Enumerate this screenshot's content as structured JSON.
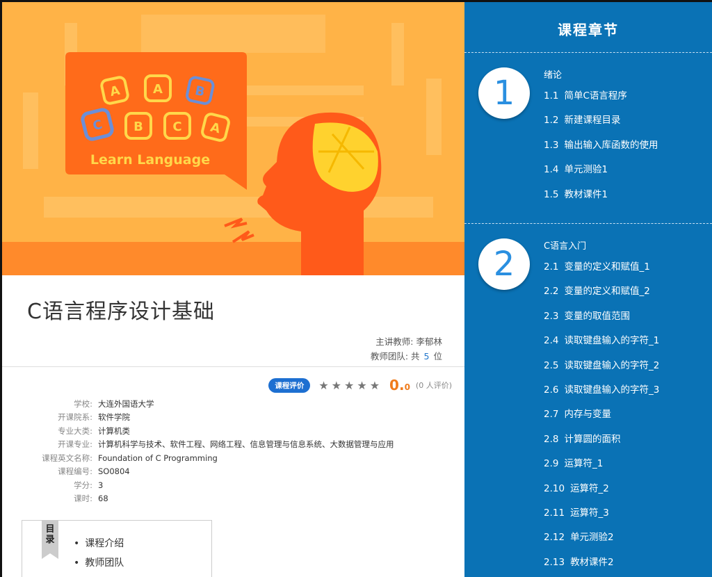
{
  "banner": {
    "sign_text": "Learn Language",
    "blocks": [
      "A",
      "A",
      "B",
      "C",
      "B",
      "C",
      "A"
    ]
  },
  "course": {
    "title": "C语言程序设计基础",
    "teacher_label": "主讲教师:",
    "teacher_name": "李郁林",
    "team_label": "教师团队:",
    "team_prefix": "共",
    "team_count": "5",
    "team_suffix": "位"
  },
  "rating": {
    "badge": "课程评价",
    "stars": [
      "★",
      "★",
      "★",
      "★",
      "★"
    ],
    "score_int": "0.",
    "score_dec": "0",
    "count": "(0 人评价)"
  },
  "info": [
    {
      "k": "学校:",
      "v": "大连外国语大学"
    },
    {
      "k": "开课院系:",
      "v": "软件学院"
    },
    {
      "k": "专业大类:",
      "v": "计算机类"
    },
    {
      "k": "开课专业:",
      "v": "计算机科学与技术、软件工程、网络工程、信息管理与信息系统、大数据管理与应用"
    },
    {
      "k": "课程英文名称:",
      "v": "Foundation of C Programming"
    },
    {
      "k": "课程编号:",
      "v": "SO0804"
    },
    {
      "k": "学分:",
      "v": "3"
    },
    {
      "k": "课时:",
      "v": "68"
    }
  ],
  "toc": {
    "tag_1": "目",
    "tag_2": "录",
    "items": [
      "课程介绍",
      "教师团队"
    ]
  },
  "sidebar": {
    "title": "课程章节",
    "chapters": [
      {
        "num": "1",
        "name": "绪论",
        "lessons": [
          {
            "num": "1.1",
            "title": "简单C语言程序"
          },
          {
            "num": "1.2",
            "title": "新建课程目录"
          },
          {
            "num": "1.3",
            "title": "输出输入库函数的使用"
          },
          {
            "num": "1.4",
            "title": "单元测验1"
          },
          {
            "num": "1.5",
            "title": "教材课件1"
          }
        ]
      },
      {
        "num": "2",
        "name": "C语言入门",
        "lessons": [
          {
            "num": "2.1",
            "title": "变量的定义和赋值_1"
          },
          {
            "num": "2.2",
            "title": "变量的定义和赋值_2"
          },
          {
            "num": "2.3",
            "title": "变量的取值范围"
          },
          {
            "num": "2.4",
            "title": "读取键盘输入的字符_1"
          },
          {
            "num": "2.5",
            "title": "读取键盘输入的字符_2"
          },
          {
            "num": "2.6",
            "title": "读取键盘输入的字符_3"
          },
          {
            "num": "2.7",
            "title": "内存与变量"
          },
          {
            "num": "2.8",
            "title": "计算圆的面积"
          },
          {
            "num": "2.9",
            "title": "运算符_1"
          },
          {
            "num": "2.10",
            "title": "运算符_2"
          },
          {
            "num": "2.11",
            "title": "运算符_3"
          },
          {
            "num": "2.12",
            "title": "单元测验2"
          },
          {
            "num": "2.13",
            "title": "教材课件2"
          }
        ]
      }
    ]
  }
}
